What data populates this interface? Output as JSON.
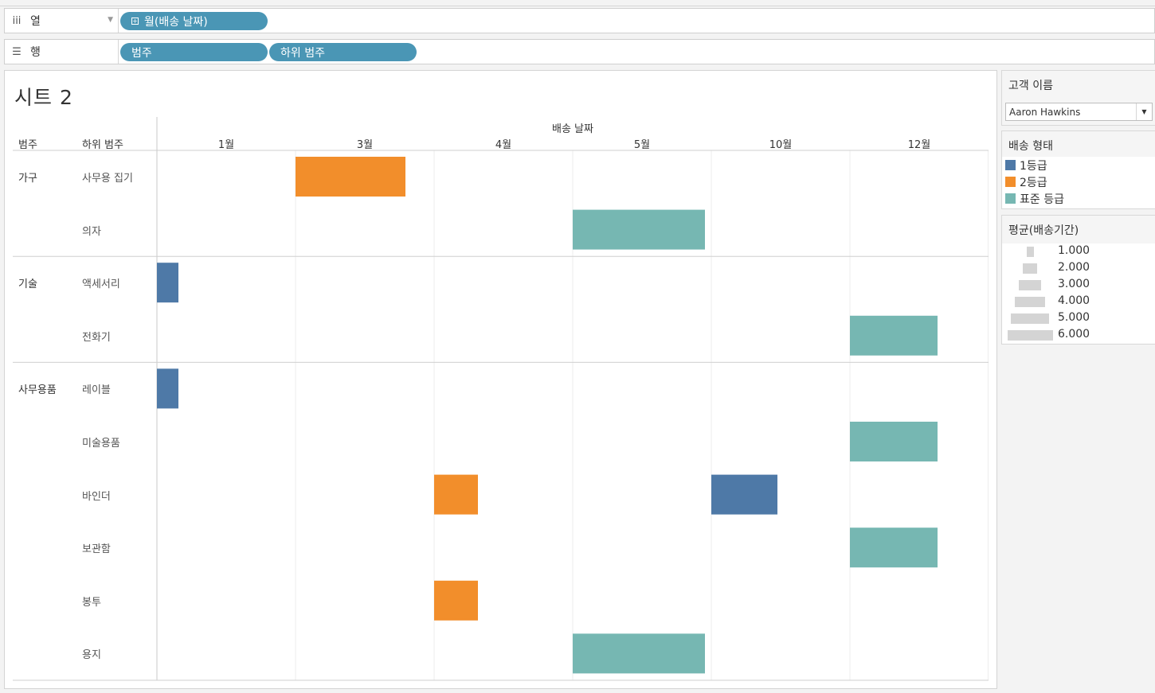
{
  "shelves": {
    "columns": {
      "label": "열",
      "icon": "columns-icon",
      "pills": [
        "월(배송 날짜)"
      ]
    },
    "rows": {
      "label": "행",
      "icon": "rows-icon",
      "pills": [
        "범주",
        "하위 범주"
      ]
    }
  },
  "sheet": {
    "title": "시트 2",
    "row_header_1": "범주",
    "row_header_2": "하위 범주",
    "col_header": "배송 날짜"
  },
  "filters": {
    "customer": {
      "title": "고객 이름",
      "value": "Aaron Hawkins"
    }
  },
  "color_legend": {
    "title": "배송 형태",
    "items": [
      {
        "label": "1등급",
        "color": "#4e79a7"
      },
      {
        "label": "2등급",
        "color": "#f28e2b"
      },
      {
        "label": "표준 등급",
        "color": "#76b7b2"
      }
    ]
  },
  "size_legend": {
    "title": "평균(배송기간)",
    "items": [
      "1.000",
      "2.000",
      "3.000",
      "4.000",
      "5.000",
      "6.000"
    ],
    "values": [
      1,
      2,
      3,
      4,
      5,
      6
    ]
  },
  "chart_data": {
    "type": "bar",
    "columns": [
      "1월",
      "3월",
      "4월",
      "5월",
      "10월",
      "12월"
    ],
    "categories": [
      {
        "name": "가구",
        "subs": [
          "사무용 집기",
          "의자"
        ]
      },
      {
        "name": "기술",
        "subs": [
          "액세서리",
          "전화기"
        ]
      },
      {
        "name": "사무용품",
        "subs": [
          "레이블",
          "미술용품",
          "바인더",
          "보관함",
          "봉투",
          "용지"
        ]
      }
    ],
    "marks": [
      {
        "sub": "사무용 집기",
        "month": "3월",
        "ship_mode": "2등급",
        "avg_days": 5
      },
      {
        "sub": "의자",
        "month": "5월",
        "ship_mode": "표준 등급",
        "avg_days": 6
      },
      {
        "sub": "액세서리",
        "month": "1월",
        "ship_mode": "1등급",
        "avg_days": 1
      },
      {
        "sub": "전화기",
        "month": "12월",
        "ship_mode": "표준 등급",
        "avg_days": 4
      },
      {
        "sub": "레이블",
        "month": "1월",
        "ship_mode": "1등급",
        "avg_days": 1
      },
      {
        "sub": "미술용품",
        "month": "12월",
        "ship_mode": "표준 등급",
        "avg_days": 4
      },
      {
        "sub": "바인더",
        "month": "4월",
        "ship_mode": "2등급",
        "avg_days": 2
      },
      {
        "sub": "바인더",
        "month": "10월",
        "ship_mode": "1등급",
        "avg_days": 3
      },
      {
        "sub": "보관함",
        "month": "12월",
        "ship_mode": "표준 등급",
        "avg_days": 4
      },
      {
        "sub": "봉투",
        "month": "4월",
        "ship_mode": "2등급",
        "avg_days": 2
      },
      {
        "sub": "용지",
        "month": "5월",
        "ship_mode": "표준 등급",
        "avg_days": 6
      }
    ]
  }
}
